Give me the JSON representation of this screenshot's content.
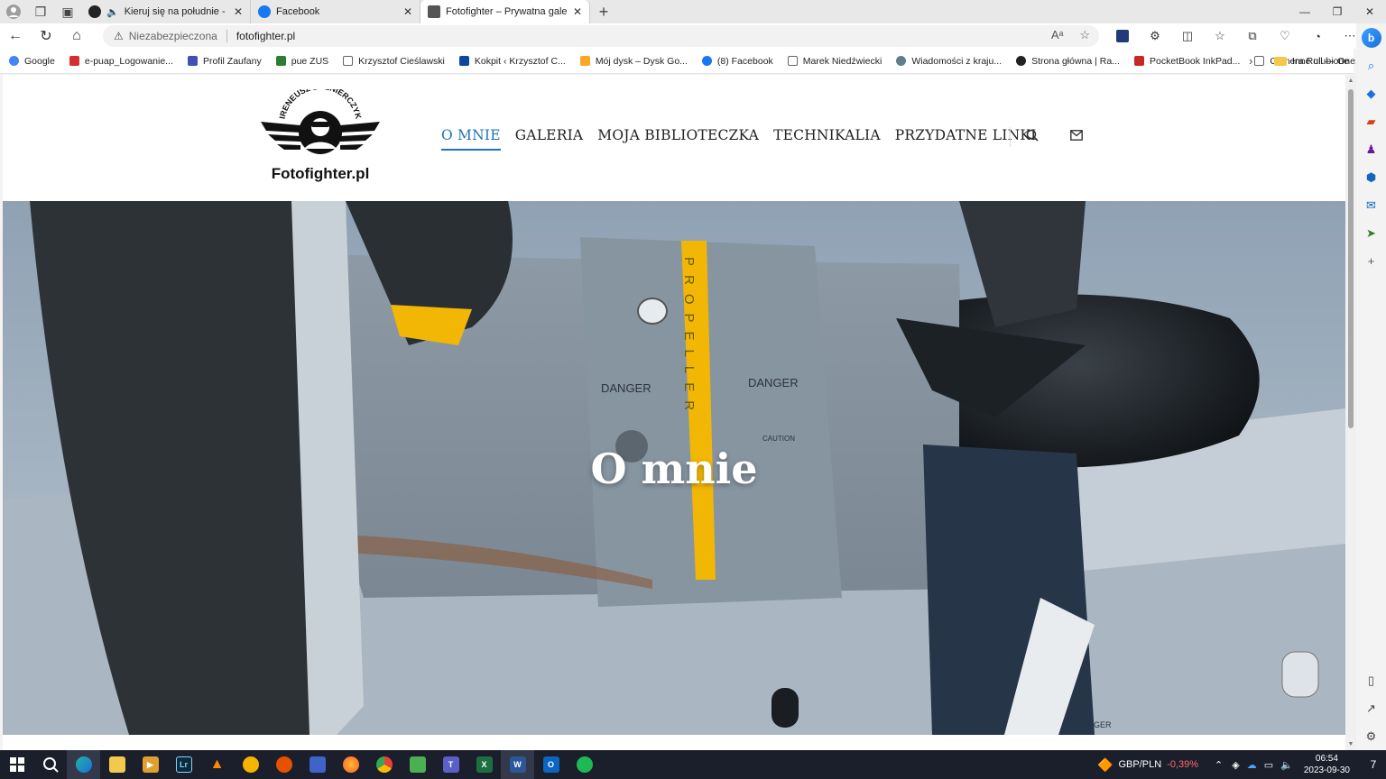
{
  "browser": {
    "tabs": [
      {
        "title": "Kieruj się na południe - Rad",
        "favicon_color": "#222222"
      },
      {
        "title": "Facebook",
        "favicon_color": "#1877f2"
      },
      {
        "title": "Fotofighter – Prywatna galeria zd",
        "favicon_color": "#555555"
      }
    ],
    "new_tab": "+",
    "address": {
      "security": "Niezabezpieczona",
      "url": "fotofighter.pl"
    },
    "bookmarks": [
      {
        "label": "Google",
        "color": "#4285f4"
      },
      {
        "label": "e-puap_Logowanie...",
        "color": "#d32f2f"
      },
      {
        "label": "Profil Zaufany",
        "color": "#3f51b5"
      },
      {
        "label": "pue ZUS",
        "color": "#2e7d32"
      },
      {
        "label": "Krzysztof Cieślawski",
        "color": "#888888"
      },
      {
        "label": "Kokpit ‹ Krzysztof C...",
        "color": "#0d47a1"
      },
      {
        "label": "Mój dysk – Dysk Go...",
        "color": "#f9a825"
      },
      {
        "label": "(8) Facebook",
        "color": "#1877f2"
      },
      {
        "label": "Marek Niedźwiecki",
        "color": "#888888"
      },
      {
        "label": "Wiadomości z kraju...",
        "color": "#607d8b"
      },
      {
        "label": "Strona główna | Ra...",
        "color": "#222222"
      },
      {
        "label": "PocketBook InkPad...",
        "color": "#c62828"
      },
      {
        "label": "Camera Roll — One...",
        "color": "#888888"
      }
    ],
    "other_bookmarks": "Inne ulubione"
  },
  "site": {
    "logo_name": "IRENEUSZ ŻOŁNIERCZYK",
    "logo_text": "Fotofighter.pl",
    "menu": [
      {
        "label": "O MNIE",
        "active": true
      },
      {
        "label": "GALERIA",
        "active": false
      },
      {
        "label": "MOJA BIBLIOTECZKA",
        "active": false
      },
      {
        "label": "TECHNIKALIA",
        "active": false
      },
      {
        "label": "PRZYDATNE LINKI",
        "active": false
      }
    ],
    "hero_title": "O mnie",
    "hero_markings": {
      "propeller": "PROPELLER",
      "danger_left": "DANGER",
      "danger_right": "DANGER",
      "caution": "CAUTION",
      "danger_bottom": "DANGER"
    }
  },
  "taskbar": {
    "ticker_symbol": "GBP/PLN",
    "ticker_change": "-0,39%",
    "time": "06:54",
    "date": "2023-09-30",
    "notifications": "7"
  },
  "colors": {
    "accent": "#1f73b7",
    "propeller_stripe": "#f2b705"
  }
}
